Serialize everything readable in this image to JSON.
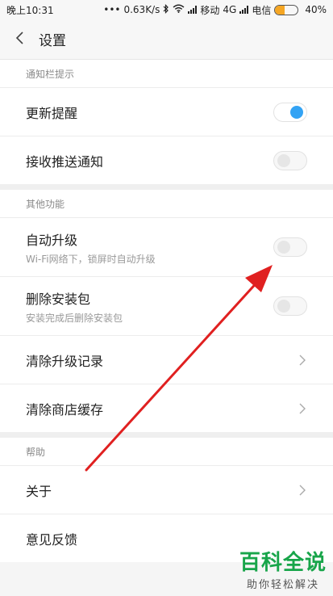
{
  "status_bar": {
    "time": "晚上10:31",
    "speed": "0.63K/s",
    "carrier1": "移动",
    "network": "4G",
    "carrier2": "电信",
    "battery_pct": "40%",
    "battery_level": 0.4,
    "battery_color": "#f5a623"
  },
  "header": {
    "title": "设置"
  },
  "sections": {
    "notification": {
      "header": "通知栏提示",
      "items": [
        {
          "title": "更新提醒",
          "toggle_on": true
        },
        {
          "title": "接收推送通知",
          "toggle_on": false
        }
      ]
    },
    "other": {
      "header": "其他功能",
      "items": [
        {
          "title": "自动升级",
          "subtitle": "Wi-Fi网络下，锁屏时自动升级",
          "toggle_on": false
        },
        {
          "title": "删除安装包",
          "subtitle": "安装完成后删除安装包",
          "toggle_on": false
        },
        {
          "title": "清除升级记录"
        },
        {
          "title": "清除商店缓存"
        }
      ]
    },
    "help": {
      "header": "帮助",
      "items": [
        {
          "title": "关于"
        },
        {
          "title": "意见反馈"
        }
      ]
    }
  },
  "watermark": {
    "main": "百科全说",
    "sub": "助你轻松解决"
  },
  "colors": {
    "accent": "#33a3f4",
    "annotation_arrow": "#e02020",
    "watermark": "#18a54a"
  }
}
